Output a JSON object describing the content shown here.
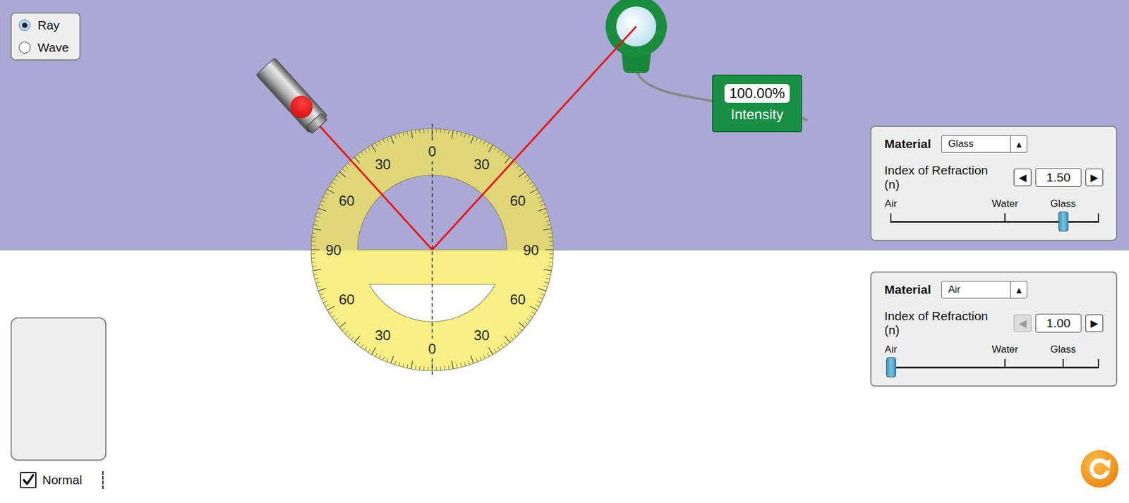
{
  "view_mode": [
    {
      "label": "Ray",
      "selected": true
    },
    {
      "label": "Wave",
      "selected": false
    }
  ],
  "protractor": {
    "upper_labels": [
      "90",
      "60",
      "30",
      "0",
      "30",
      "60",
      "90"
    ],
    "lower_labels": [
      "60",
      "30",
      "0",
      "30",
      "60"
    ]
  },
  "laser": {
    "on": true
  },
  "intensity_meter": {
    "reading": "100.00%",
    "label": "Intensity"
  },
  "materials": [
    {
      "label": "Material",
      "selected": "Glass",
      "dropdown_icon": "▲",
      "index_label": "Index of Refraction (n)",
      "value": "1.50",
      "decrease_icon": "◀",
      "increase_icon": "▶",
      "decrease_disabled": false,
      "increase_disabled": false,
      "level": 0.83,
      "scale": [
        {
          "text": "Air",
          "level": 0
        },
        {
          "text": "Water",
          "level": 0.55
        },
        {
          "text": "Glass",
          "level": 0.83
        }
      ]
    },
    {
      "label": "Material",
      "selected": "Air",
      "dropdown_icon": "▲",
      "index_label": "Index of Refraction (n)",
      "value": "1.00",
      "decrease_icon": "◀",
      "increase_icon": "▶",
      "decrease_disabled": true,
      "increase_disabled": false,
      "level": 0,
      "scale": [
        {
          "text": "Air",
          "level": 0
        },
        {
          "text": "Water",
          "level": 0.55
        },
        {
          "text": "Glass",
          "level": 0.83
        }
      ]
    }
  ],
  "normal": {
    "label": "Normal",
    "checked": true
  }
}
